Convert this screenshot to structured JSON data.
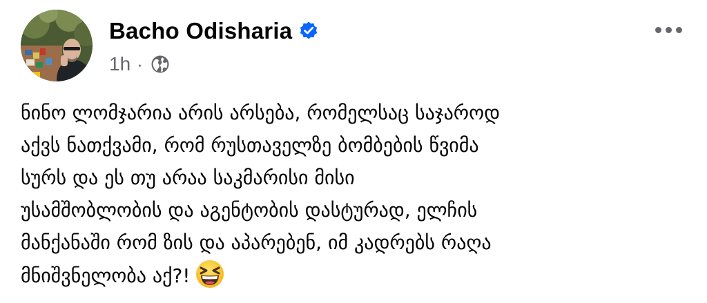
{
  "post": {
    "author": "Bacho Odisharia",
    "verified": true,
    "time": "1h",
    "separator": "·",
    "audience_icon": "globe-icon",
    "more_icon": "more-horizontal-icon",
    "lines": [
      "ნინო ლომჯარია არის არსება, რომელსაც საჯაროდ",
      "აქვს ნათქვამი, რომ რუსთაველზე ბომბების წვიმა",
      "სურს და ეს თუ არაა საკმარისი მისი",
      "უსამშობლობის და აგენტობის დასტურად, ელჩის",
      "მანქანაში რომ ზის და აპარებენ, იმ კადრებს რაღა",
      "მნიშვნელობა აქ?!"
    ],
    "emoji": "grinning-squinting-face-icon"
  },
  "colors": {
    "text": "#050505",
    "secondary": "#65676b",
    "verified_badge": "#0866ff",
    "emoji_face": "#ffc83d"
  }
}
